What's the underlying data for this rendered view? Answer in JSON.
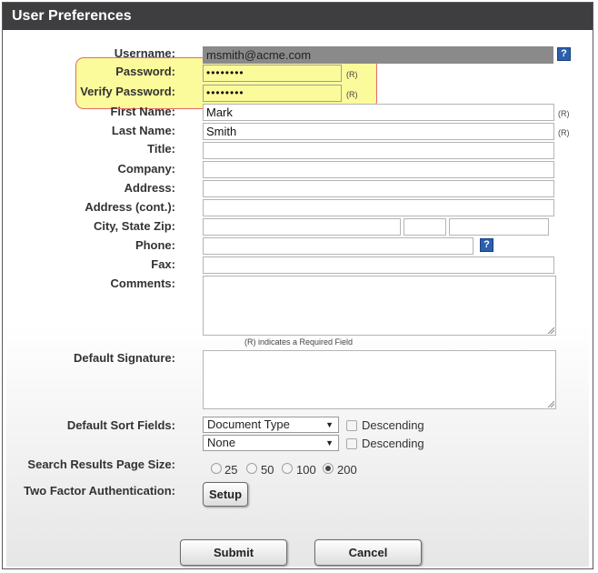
{
  "window": {
    "title": "User Preferences"
  },
  "labels": {
    "username": "Username:",
    "password": "Password:",
    "verify_password": "Verify Password:",
    "first_name": "First Name:",
    "last_name": "Last Name:",
    "title": "Title:",
    "company": "Company:",
    "address": "Address:",
    "address_cont": "Address (cont.):",
    "city_state_zip": "City, State Zip:",
    "phone": "Phone:",
    "fax": "Fax:",
    "comments": "Comments:",
    "default_signature": "Default Signature:",
    "default_sort_fields": "Default Sort Fields:",
    "search_page_size": "Search Results Page Size:",
    "two_factor": "Two Factor Authentication:"
  },
  "values": {
    "username": "msmith@acme.com",
    "password": "••••••••",
    "verify_password": "••••••••",
    "first_name": "Mark",
    "last_name": "Smith",
    "title": "",
    "company": "",
    "address": "",
    "address_cont": "",
    "city": "",
    "state": "",
    "zip": "",
    "phone": "",
    "fax": "",
    "comments": "",
    "default_signature": ""
  },
  "required_marker": "(R)",
  "required_note": "(R) indicates a Required Field",
  "help_glyph": "?",
  "sort": {
    "field1_selected": "Document Type",
    "field2_selected": "None",
    "descending_label": "Descending",
    "dropdown_arrow": "▼"
  },
  "page_size": {
    "options": [
      "25",
      "50",
      "100",
      "200"
    ],
    "selected": "200"
  },
  "buttons": {
    "setup": "Setup",
    "submit": "Submit",
    "cancel": "Cancel"
  },
  "colors": {
    "title_bar": "#3e3e40",
    "highlight_fill": "#fbfb9b",
    "highlight_border": "#e46a6a",
    "help_icon": "#2b5fae",
    "username_field": "#8a8a8a"
  }
}
